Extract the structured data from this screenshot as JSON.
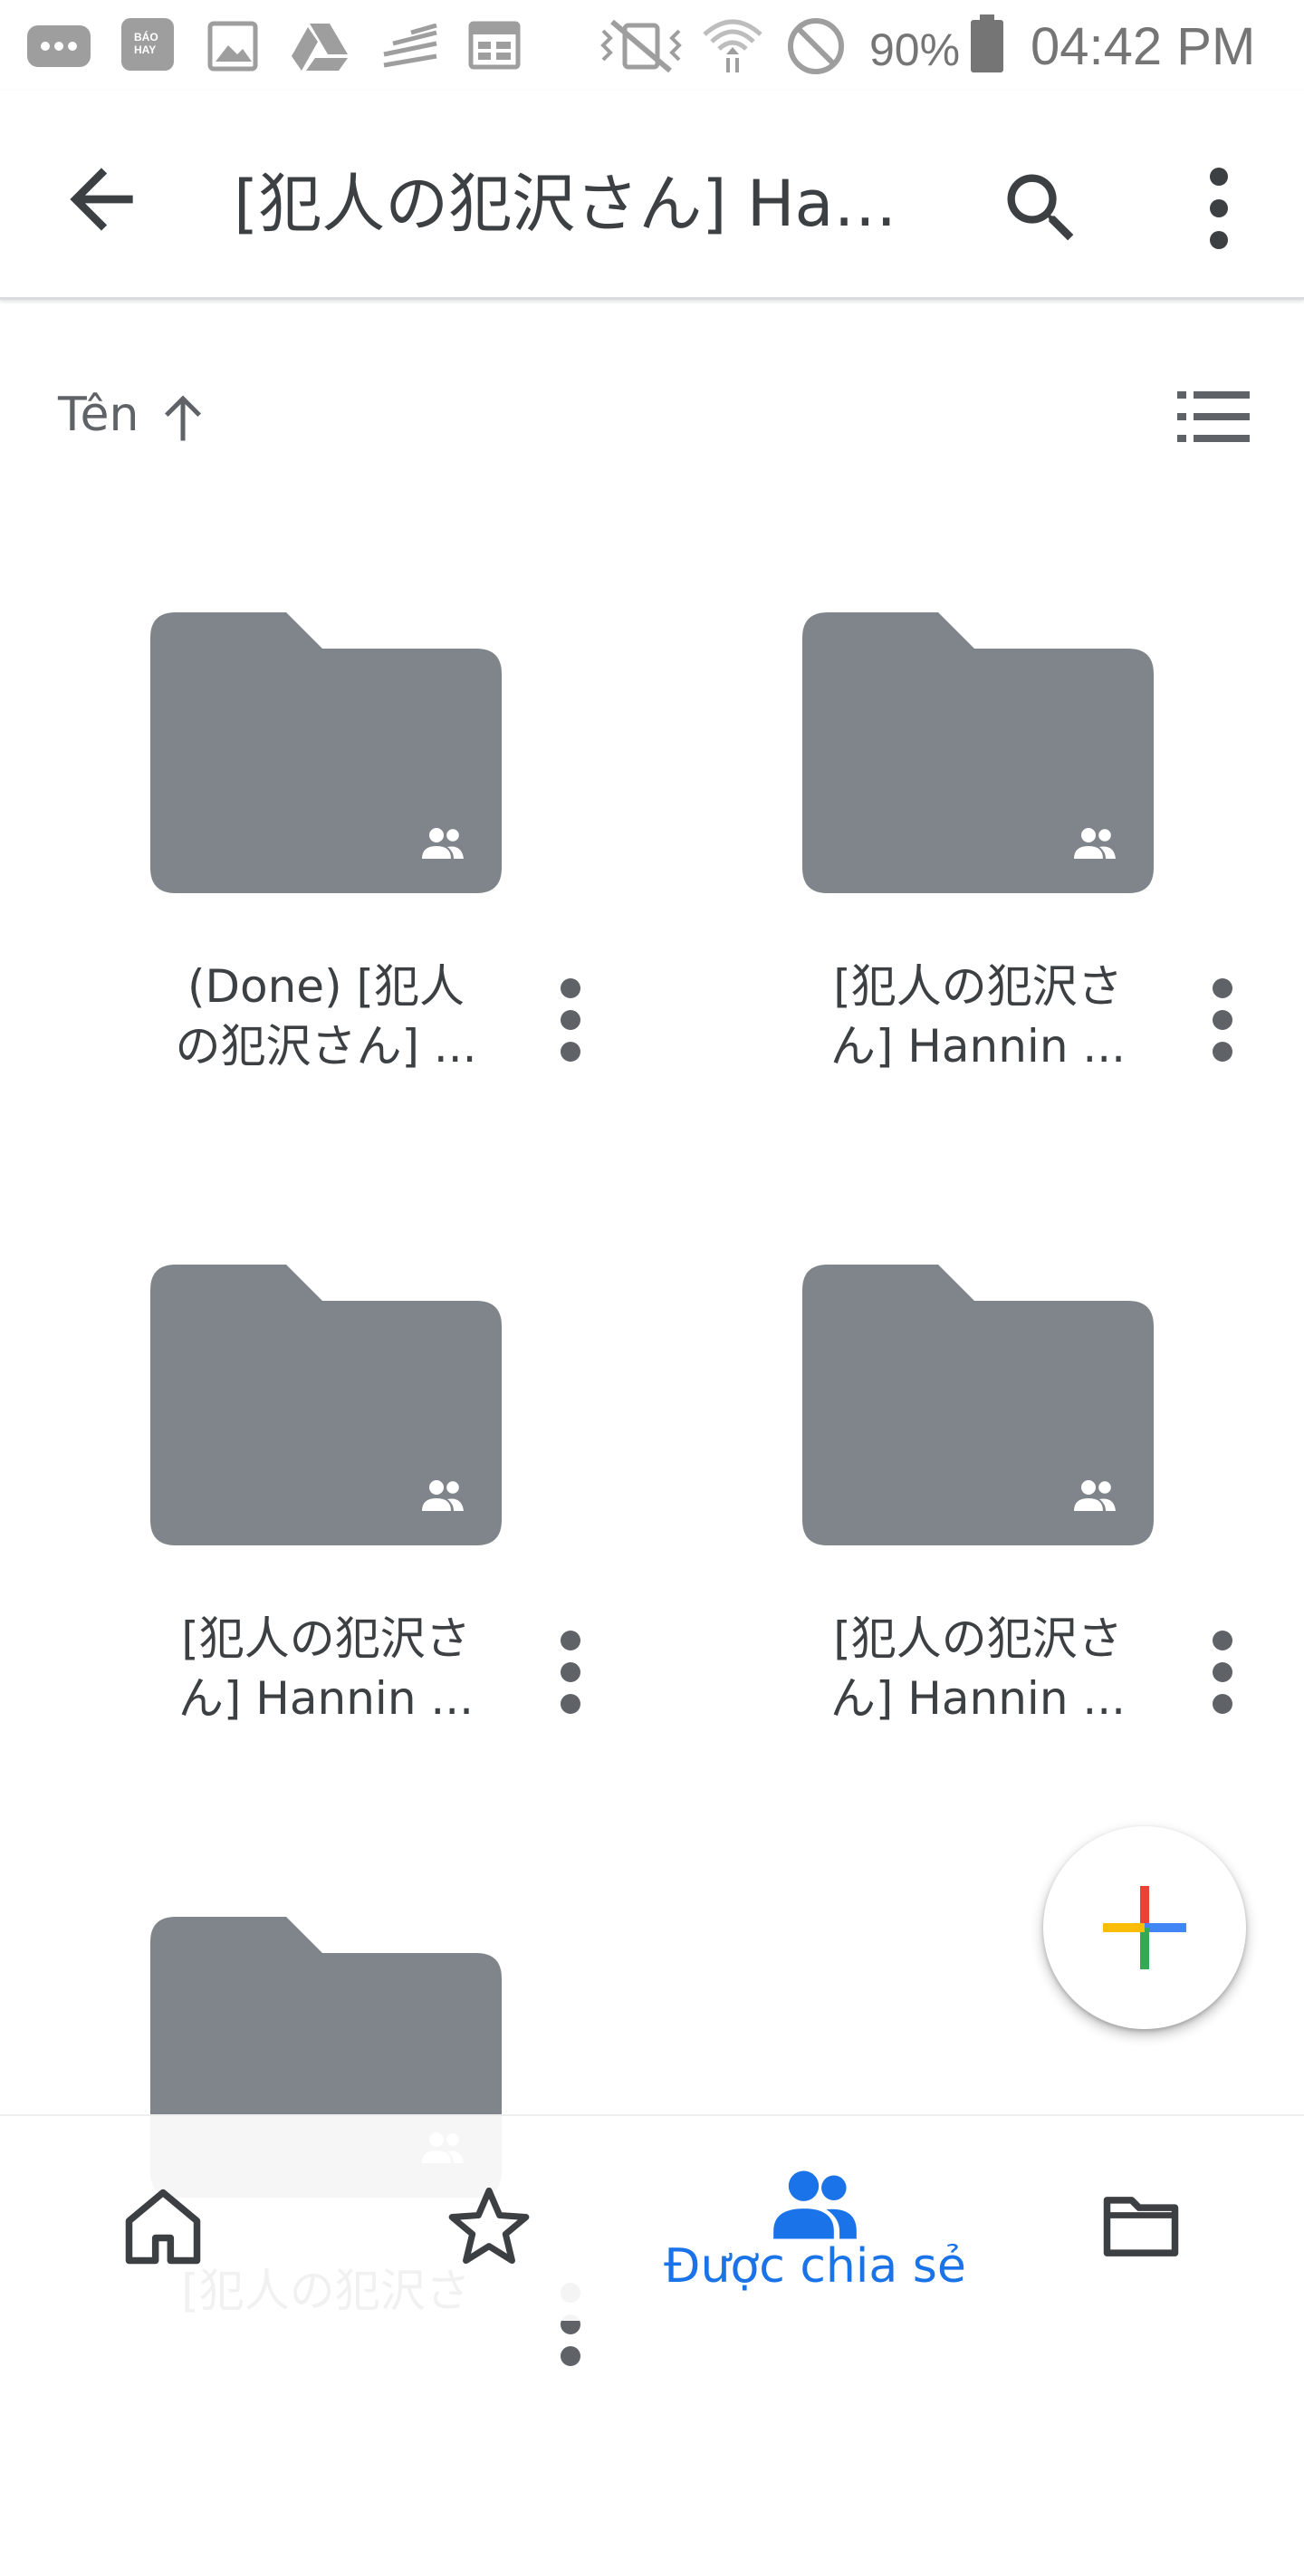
{
  "status_bar": {
    "battery": "90%",
    "time": "04:42 PM",
    "icons": [
      "messenger-icon",
      "bao-hay-icon",
      "gallery-icon",
      "drive-icon",
      "signal-bars-icon",
      "calendar-icon",
      "vibrate-mute-icon",
      "wifi-icon",
      "do-not-disturb-icon",
      "battery-icon"
    ],
    "bao_hay_label": "BÁO HAY"
  },
  "app_bar": {
    "title": "[犯人の犯沢さん] Han...",
    "back_icon": "arrow-back-icon",
    "search_icon": "search-icon",
    "more_icon": "more-vert-icon"
  },
  "sort": {
    "label": "Tên",
    "direction_icon": "arrow-up-icon",
    "view_toggle_icon": "list-view-icon"
  },
  "folders": [
    {
      "line1": "(Done) [犯人",
      "line2": "の犯沢さん] ...",
      "shared": true
    },
    {
      "line1": "[犯人の犯沢さ",
      "line2": "ん] Hannin ...",
      "shared": true
    },
    {
      "line1": "[犯人の犯沢さ",
      "line2": "ん] Hannin ...",
      "shared": true
    },
    {
      "line1": "[犯人の犯沢さ",
      "line2": "ん] Hannin ...",
      "shared": true
    },
    {
      "line1": "[犯人の犯沢さ",
      "line2": "",
      "shared": true
    }
  ],
  "fab": {
    "icon": "plus-icon"
  },
  "bottom_nav": {
    "items": [
      {
        "id": "home",
        "icon": "home-icon",
        "label": "",
        "active": false
      },
      {
        "id": "starred",
        "icon": "star-icon",
        "label": "",
        "active": false
      },
      {
        "id": "shared",
        "icon": "people-icon",
        "label": "Được chia sẻ",
        "active": true
      },
      {
        "id": "files",
        "icon": "folder-icon",
        "label": "",
        "active": false
      }
    ]
  },
  "colors": {
    "folder": "#80858b",
    "accent": "#1a73e8",
    "text": "#3c4043",
    "icon": "#5f6368"
  }
}
